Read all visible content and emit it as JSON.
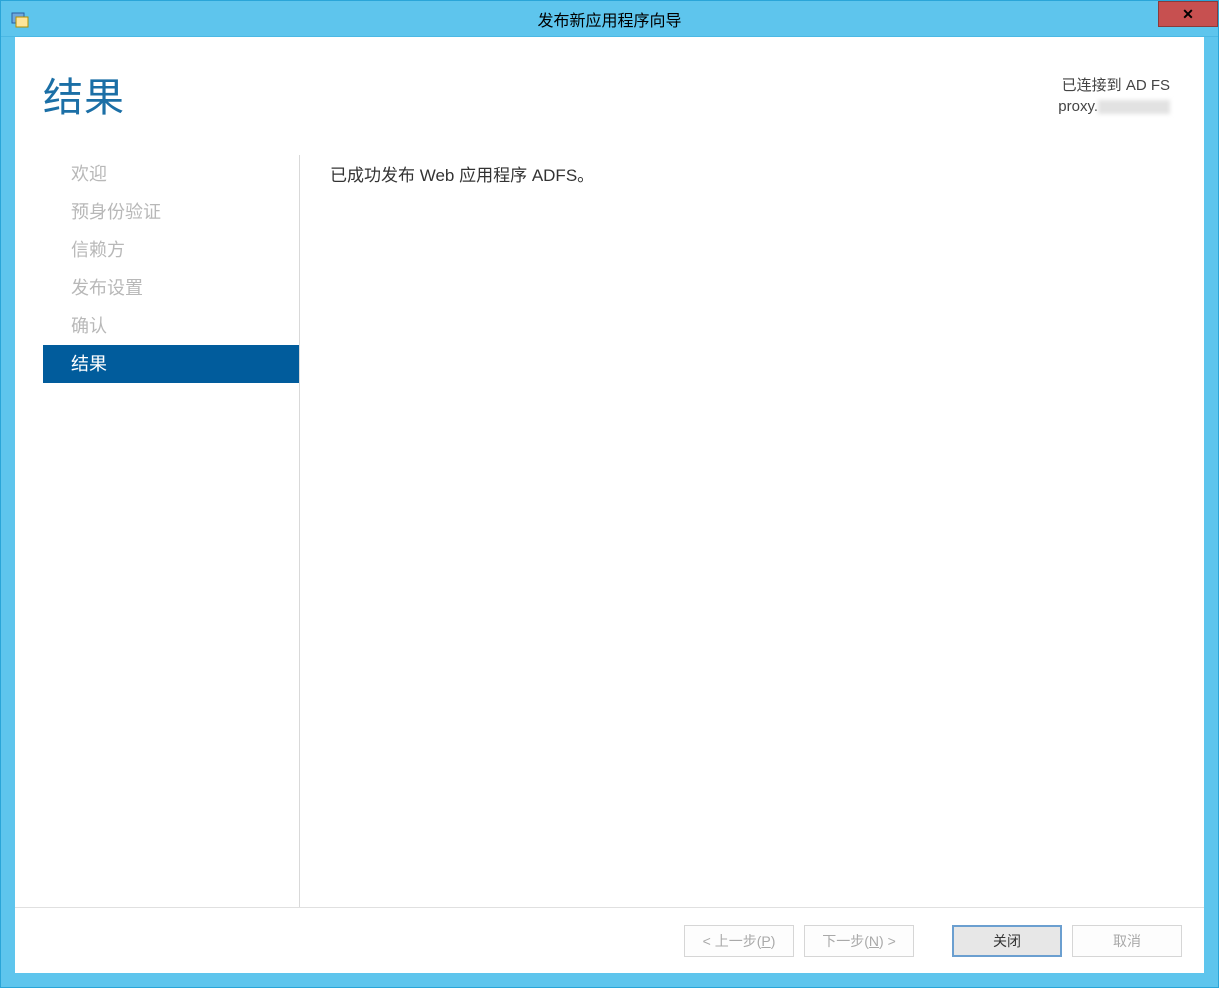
{
  "window": {
    "title": "发布新应用程序向导",
    "close_glyph": "✕"
  },
  "header": {
    "page_title": "结果",
    "status_line1": "已连接到 AD FS",
    "status_line2_prefix": "proxy."
  },
  "sidebar": {
    "items": [
      {
        "label": "欢迎",
        "active": false
      },
      {
        "label": "预身份验证",
        "active": false
      },
      {
        "label": "信赖方",
        "active": false
      },
      {
        "label": "发布设置",
        "active": false
      },
      {
        "label": "确认",
        "active": false
      },
      {
        "label": "结果",
        "active": true
      }
    ]
  },
  "content": {
    "message": "已成功发布 Web 应用程序 ADFS。"
  },
  "footer": {
    "prev_label_pre": "< 上一步(",
    "prev_key": "P",
    "prev_label_post": ")",
    "next_label_pre": "下一步(",
    "next_key": "N",
    "next_label_post": ") >",
    "close_label": "关闭",
    "cancel_label": "取消"
  }
}
